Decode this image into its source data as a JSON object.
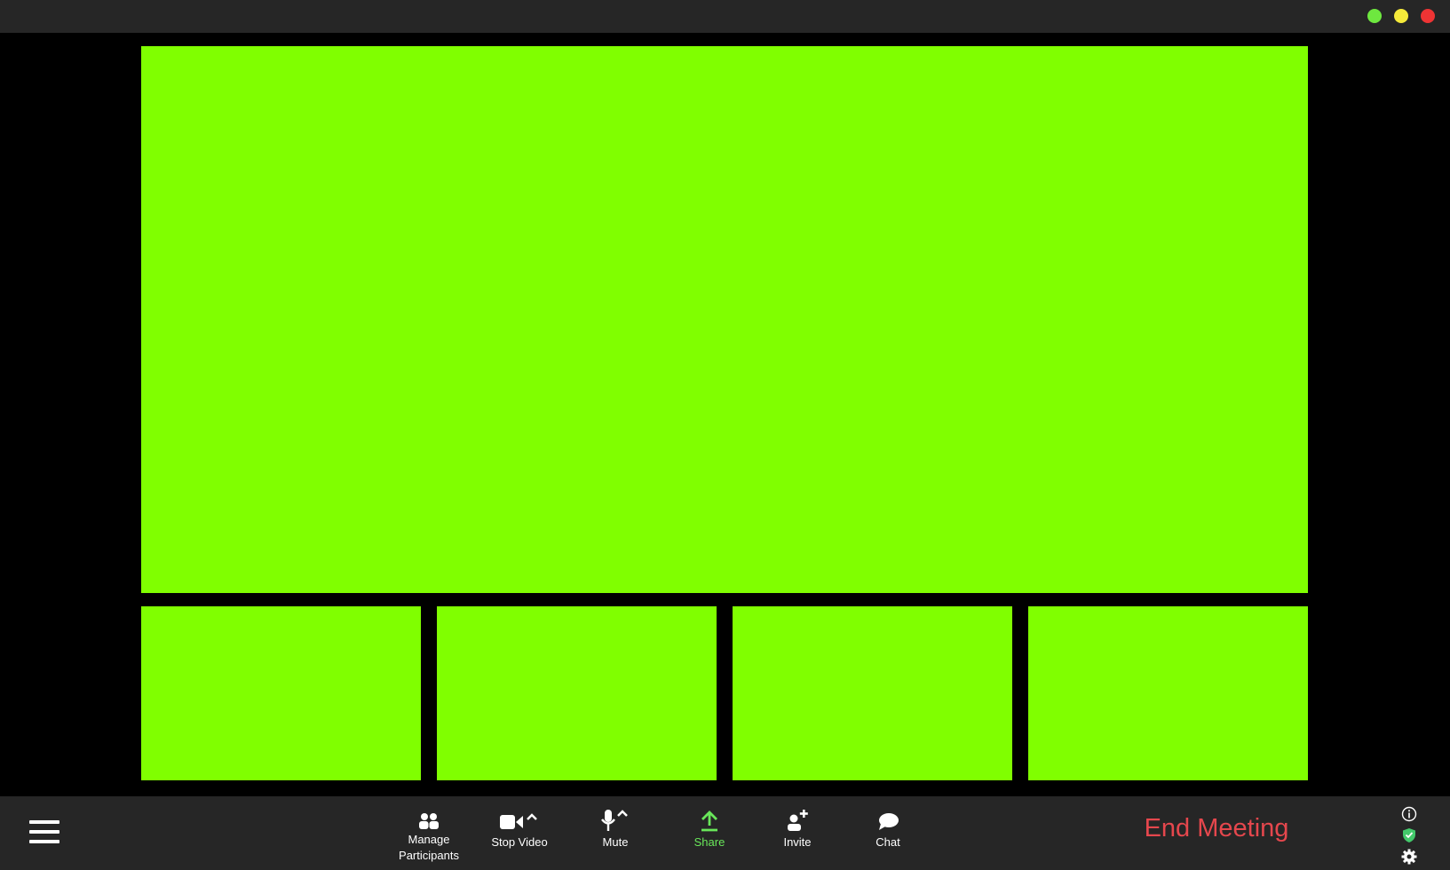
{
  "window": {
    "controls": [
      {
        "name": "maximize",
        "color": "#6ee83f"
      },
      {
        "name": "minimize",
        "color": "#f5ea3a"
      },
      {
        "name": "close",
        "color": "#ee3434"
      }
    ]
  },
  "video": {
    "tile_color": "#80ff00",
    "main_tile": "speaker",
    "thumbnails": [
      "participant-1",
      "participant-2",
      "participant-3",
      "participant-4"
    ]
  },
  "toolbar": {
    "menu_icon": "hamburger-menu-icon",
    "buttons": [
      {
        "id": "manage-participants",
        "label_line1": "Manage",
        "label_line2": "Participants",
        "icon": "participants-icon"
      },
      {
        "id": "stop-video",
        "label": "Stop Video",
        "icon": "video-camera-icon"
      },
      {
        "id": "mute",
        "label": "Mute",
        "icon": "microphone-icon"
      },
      {
        "id": "share",
        "label": "Share",
        "icon": "share-upload-icon",
        "color": "#69e75a"
      },
      {
        "id": "invite",
        "label": "Invite",
        "icon": "add-user-icon"
      },
      {
        "id": "chat",
        "label": "Chat",
        "icon": "chat-bubble-icon"
      }
    ],
    "end_meeting": {
      "label": "End Meeting",
      "color": "#e5474d"
    },
    "side_icons": [
      "info-icon",
      "security-shield-icon",
      "settings-gear-icon"
    ]
  }
}
